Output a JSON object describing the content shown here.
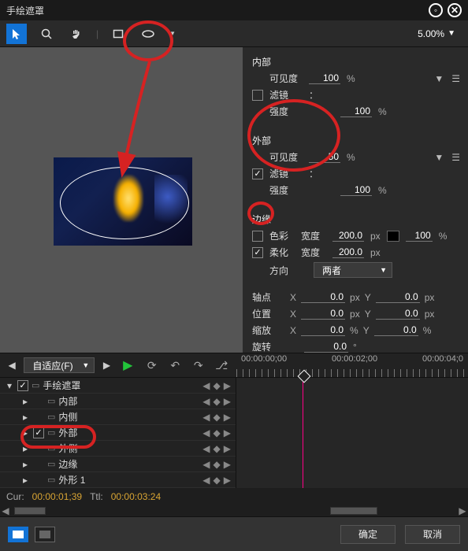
{
  "window": {
    "title": "手绘遮罩"
  },
  "toolbar": {
    "zoom": "5.00%"
  },
  "inner": {
    "title": "内部",
    "visibility_label": "可见度",
    "visibility": "100",
    "filter_label": "滤镜",
    "filter_colon": "：",
    "strength_label": "强度",
    "strength": "100"
  },
  "outer": {
    "title": "外部",
    "visibility_label": "可见度",
    "visibility": "50",
    "filter_label": "滤镜",
    "filter_colon": "：",
    "strength_label": "强度",
    "strength": "100"
  },
  "edge": {
    "title": "边缘",
    "color_label": "色彩",
    "soften_label": "柔化",
    "width_label": "宽度",
    "width1": "200.0",
    "width2": "200.0",
    "percent": "100",
    "direction_label": "方向",
    "direction_value": "两者"
  },
  "transform": {
    "anchor_label": "轴点",
    "position_label": "位置",
    "scale_label": "缩放",
    "rotate_label": "旋转",
    "x0": "0.0",
    "y0": "0.0",
    "x1": "0.0",
    "y1": "0.0",
    "sx": "0.0",
    "sy": "0.0",
    "rot": "0.0"
  },
  "units": {
    "px": "px",
    "pct": "%",
    "deg": "°",
    "X": "X",
    "Y": "Y"
  },
  "timeline": {
    "fit_label": "自适应(F)",
    "t0": "00:00:00;00",
    "t1": "00:00:02;00",
    "t2": "00:00:04;0",
    "cur_label": "Cur:",
    "cur": "00:00:01;39",
    "ttl_label": "Ttl:",
    "ttl": "00:00:03:24",
    "tracks": [
      {
        "name": "手绘遮罩",
        "checked": true
      },
      {
        "name": "内部",
        "checked": false
      },
      {
        "name": "内侧",
        "checked": false
      },
      {
        "name": "外部",
        "checked": true
      },
      {
        "name": "外侧",
        "checked": false
      },
      {
        "name": "边缘",
        "checked": false
      },
      {
        "name": "外形 1",
        "checked": false
      }
    ]
  },
  "footer": {
    "ok": "确定",
    "cancel": "取消"
  }
}
